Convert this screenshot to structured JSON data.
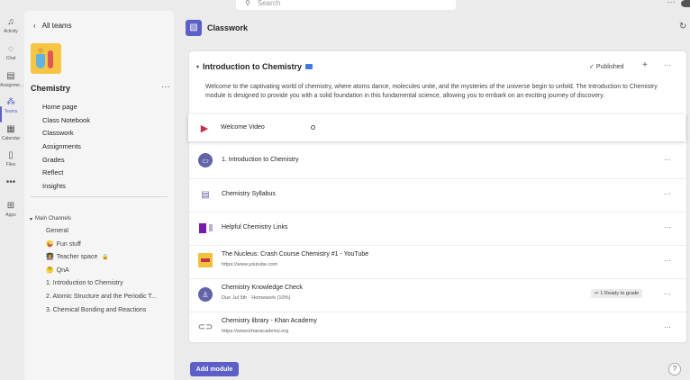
{
  "search": {
    "placeholder": "Search"
  },
  "rail": [
    {
      "label": "Activity",
      "icon": "bell-icon",
      "glyph": "🔔"
    },
    {
      "label": "Chat",
      "icon": "chat-icon",
      "glyph": "💬"
    },
    {
      "label": "Assignme...",
      "icon": "assignments-icon",
      "glyph": "📋"
    },
    {
      "label": "Teams",
      "icon": "teams-icon",
      "glyph": "👥"
    },
    {
      "label": "Calendar",
      "icon": "calendar-icon",
      "glyph": "📅"
    },
    {
      "label": "Files",
      "icon": "files-icon",
      "glyph": "📄"
    },
    {
      "label": "",
      "icon": "more-icon",
      "glyph": "•••"
    },
    {
      "label": "Apps",
      "icon": "apps-icon",
      "glyph": "⊞"
    }
  ],
  "sidebar": {
    "back_label": "All teams",
    "team_name": "Chemistry",
    "nav": [
      "Home page",
      "Class Notebook",
      "Classwork",
      "Assignments",
      "Grades",
      "Reflect",
      "Insights"
    ],
    "channels_header": "Main Channels",
    "channels": [
      {
        "label": "General",
        "emoji": ""
      },
      {
        "label": "Fun stuff",
        "emoji": "😜"
      },
      {
        "label": "Teacher space",
        "emoji": "👩‍🏫",
        "locked": true
      },
      {
        "label": "QnA",
        "emoji": "🤔"
      },
      {
        "label": "1. Introduction to Chemistry",
        "emoji": ""
      },
      {
        "label": "2. Atomic Structure and the Periodic T...",
        "emoji": ""
      },
      {
        "label": "3. Chemical Bonding and Reactions",
        "emoji": ""
      }
    ]
  },
  "main": {
    "title": "Classwork",
    "module": {
      "title": "Introduction to Chemistry",
      "status": "Published",
      "description": "Welcome to the captivating world of chemistry, where atoms dance, molecules unite, and the mysteries of the universe begin to unfold. The Introduction to Chemistry module is designed to provide you with a solid foundation in this fundamental science, allowing you to embark on an exciting journey of discovery."
    },
    "items": [
      {
        "title": "Welcome Video",
        "subtitle": "",
        "icon": "play-icon"
      },
      {
        "title": "1. Introduction to Chemistry",
        "subtitle": "",
        "icon": "channel-icon"
      },
      {
        "title": "Chemistry Syllabus",
        "subtitle": "",
        "icon": "document-icon"
      },
      {
        "title": "Helpful Chemistry Links",
        "subtitle": "",
        "icon": "onenote-icon"
      },
      {
        "title": "The Nucleus: Crash Course Chemistry #1 - YouTube",
        "subtitle": "https://www.youtube.com",
        "icon": "youtube-thumbnail-icon"
      },
      {
        "title": "Chemistry Knowledge Check",
        "subtitle": "Due Jul 5th · Homework (10%)",
        "icon": "assignment-icon",
        "badge": "1 Ready to grade"
      },
      {
        "title": "Chemistry library - Khan Academy",
        "subtitle": "https://www.khanacademy.org",
        "icon": "link-icon"
      }
    ],
    "add_module_label": "Add module"
  },
  "colors": {
    "accent": "#5b5fc7",
    "video_icon": "#c4314b"
  }
}
